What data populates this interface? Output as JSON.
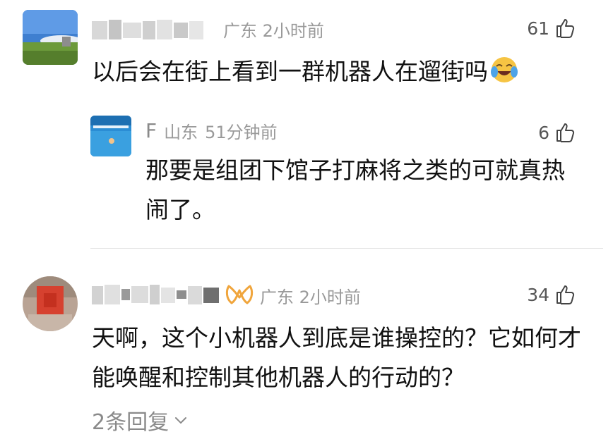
{
  "comments": [
    {
      "location": "广东",
      "time": "2小时前",
      "likes": "61",
      "text": "以后会在街上看到一群机器人在遛街吗",
      "emoji": "crying-laughing-face",
      "replies": [
        {
          "name": "F",
          "location": "山东",
          "time": "51分钟前",
          "likes": "6",
          "text": "那要是组团下馆子打麻将之类的可就真热闹了。"
        }
      ]
    },
    {
      "location": "广东",
      "time": "2小时前",
      "likes": "34",
      "badge": "vip-badge",
      "text": "天啊，这个小机器人到底是谁操控的？它如何才能唤醒和控制其他机器人的行动的？",
      "replies_link": "2条回复"
    }
  ],
  "colors": {
    "meta_text": "#9a9a9a",
    "body_text": "#111111",
    "badge": "#f0a53c",
    "divider": "#e6e6e6"
  }
}
